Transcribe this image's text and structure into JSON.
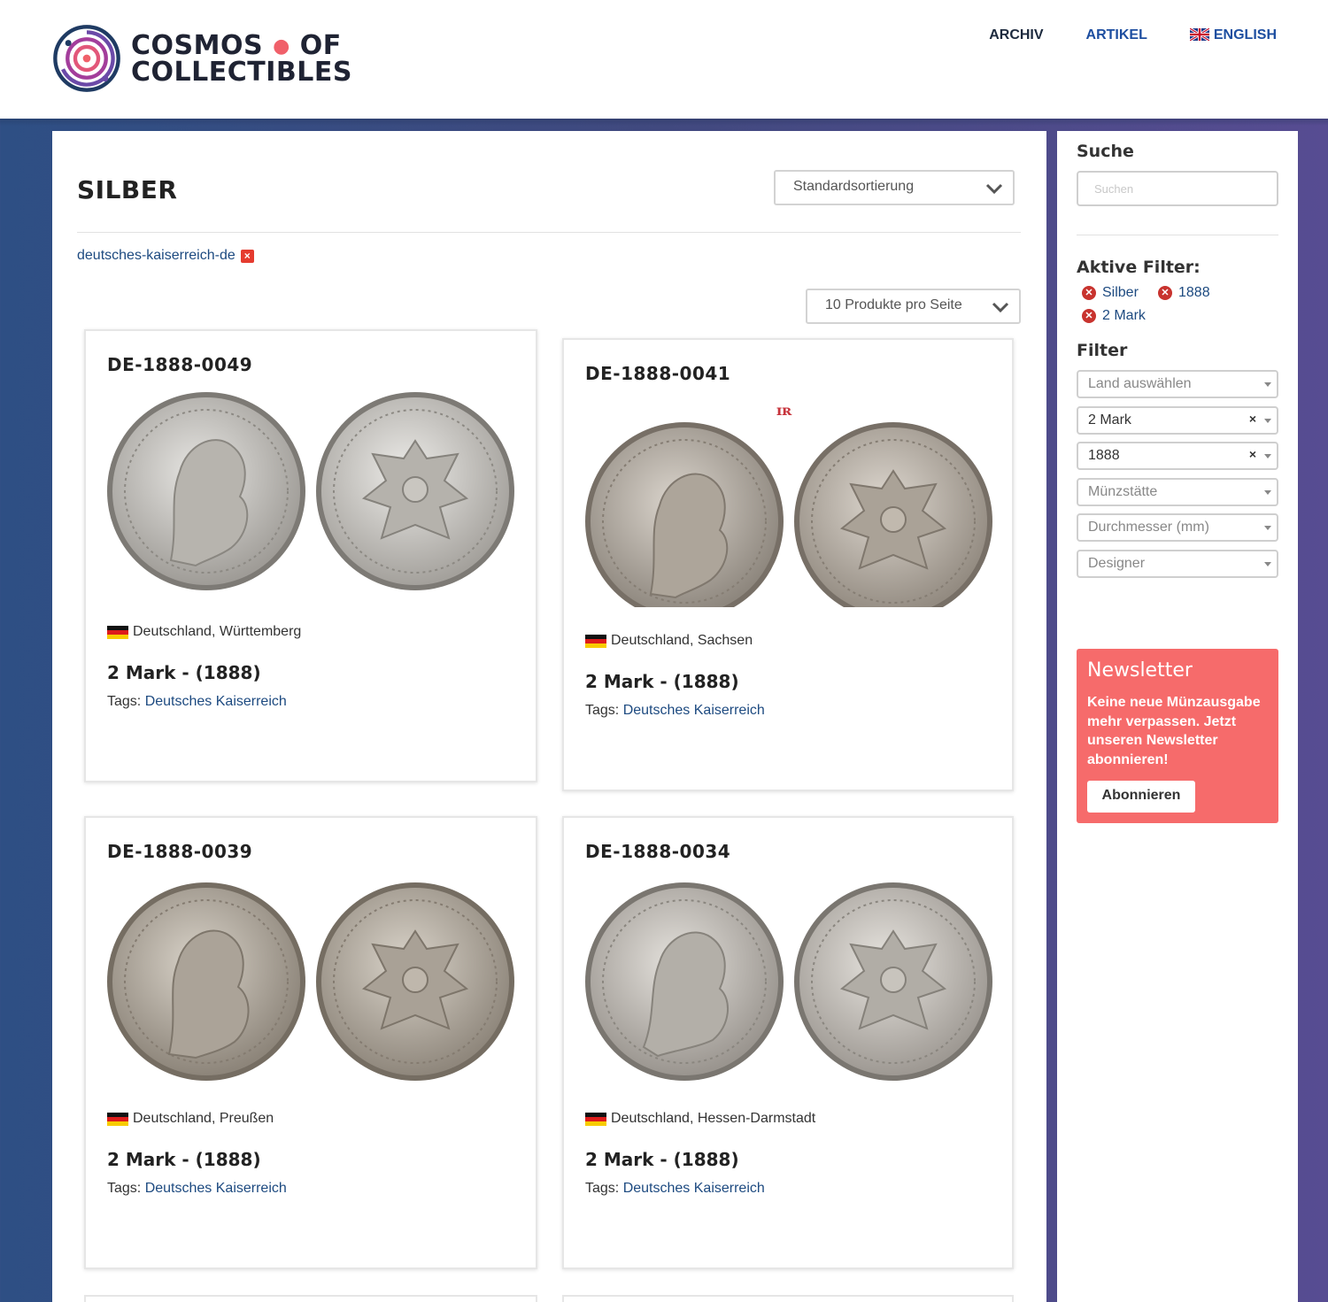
{
  "header": {
    "logo_line1": "COSMOS",
    "logo_dot": "●",
    "logo_of": "OF",
    "logo_line2": "COLLECTIBLES",
    "nav": {
      "archiv": "ARCHIV",
      "artikel": "ARTIKEL",
      "english": "ENGLISH"
    }
  },
  "main": {
    "title": "SILBER",
    "sort_label": "Standardsortierung",
    "active_tag": "deutsches-kaiserreich-de",
    "per_page_label": "10 Produkte pro Seite",
    "products": [
      {
        "code": "DE-1888-0049",
        "country": "Deutschland, Württemberg",
        "denomination": "2 Mark - (1888)",
        "tags_label": "Tags:",
        "tag": "Deutsches Kaiserreich"
      },
      {
        "code": "DE-1888-0041",
        "country": "Deutschland, Sachsen",
        "denomination": "2 Mark - (1888)",
        "tags_label": "Tags:",
        "tag": "Deutsches Kaiserreich",
        "mint_mark": "ɪʀ"
      },
      {
        "code": "DE-1888-0039",
        "country": "Deutschland, Preußen",
        "denomination": "2 Mark - (1888)",
        "tags_label": "Tags:",
        "tag": "Deutsches Kaiserreich"
      },
      {
        "code": "DE-1888-0034",
        "country": "Deutschland, Hessen-Darmstadt",
        "denomination": "2 Mark - (1888)",
        "tags_label": "Tags:",
        "tag": "Deutsches Kaiserreich"
      }
    ]
  },
  "sidebar": {
    "search_heading": "Suche",
    "search_placeholder": "Suchen",
    "active_filters_heading": "Aktive Filter:",
    "active_filters": [
      "Silber",
      "1888",
      "2 Mark"
    ],
    "filter_heading": "Filter",
    "filters": {
      "land": "Land auswählen",
      "nominal": "2 Mark",
      "jahr": "1888",
      "muenzstaette": "Münzstätte",
      "durchmesser": "Durchmesser (mm)",
      "designer": "Designer"
    },
    "newsletter": {
      "title": "Newsletter",
      "text": "Keine neue Münzausgabe mehr verpassen. Jetzt unseren Newsletter abonnieren!",
      "button": "Abonnieren"
    }
  },
  "colors": {
    "accent_coral": "#f66b6b",
    "link_blue": "#1d4a80",
    "nav_blue": "#1d4ea0"
  }
}
